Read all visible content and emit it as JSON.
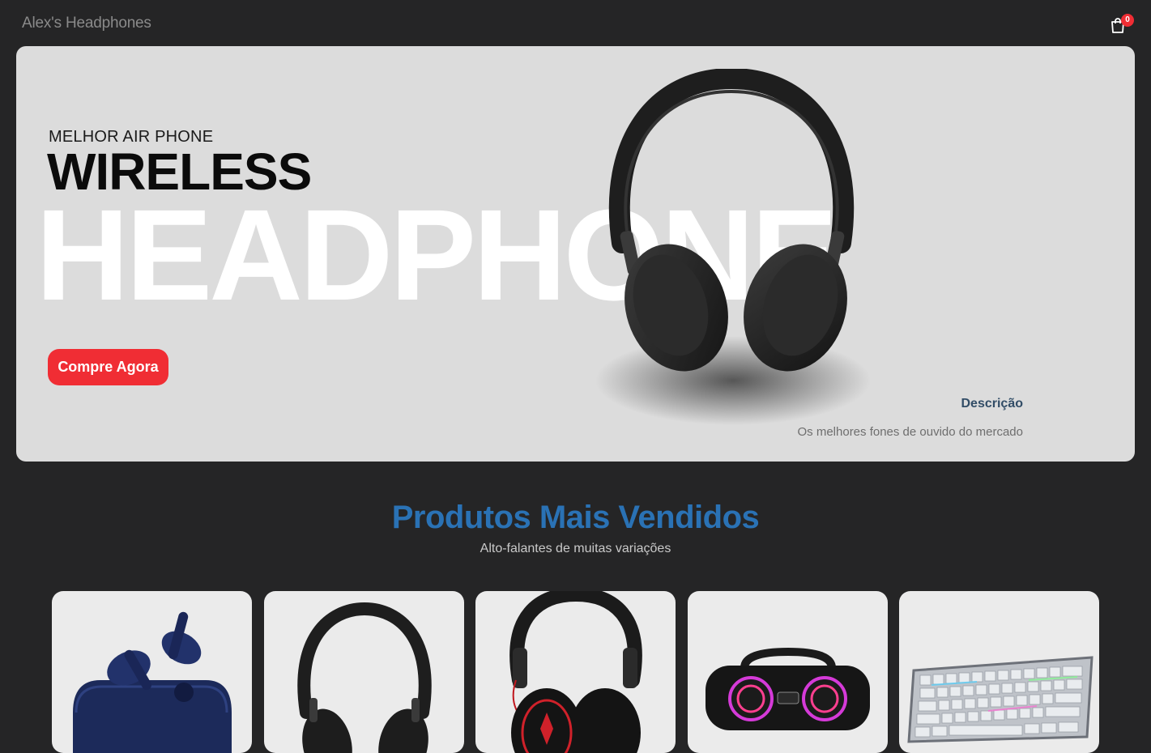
{
  "navbar": {
    "logo": "Alex's Headphones",
    "cart_icon": "shopping-bag-icon",
    "cart_qty": "0"
  },
  "hero": {
    "small_text": "MELHOR AIR PHONE",
    "mid_text": "WIRELESS",
    "large_text": "HEADPHONE",
    "button_label": "Compre Agora",
    "desc_title": "Descrição",
    "desc_text": "Os melhores fones de ouvido do mercado"
  },
  "products_section": {
    "title": "Produtos Mais Vendidos",
    "subtitle": "Alto-falantes de muitas variações"
  },
  "products": [
    {
      "image": "earbuds-image"
    },
    {
      "image": "headphone-image"
    },
    {
      "image": "gaming-headset-image"
    },
    {
      "image": "speaker-image"
    },
    {
      "image": "keyboard-image"
    }
  ],
  "colors": {
    "background": "#252526",
    "accent_red": "#f02d34",
    "title_blue": "#2a72b5",
    "desc_navy": "#324d67",
    "hero_bg": "#dcdcdc",
    "card_bg": "#ebebeb"
  }
}
